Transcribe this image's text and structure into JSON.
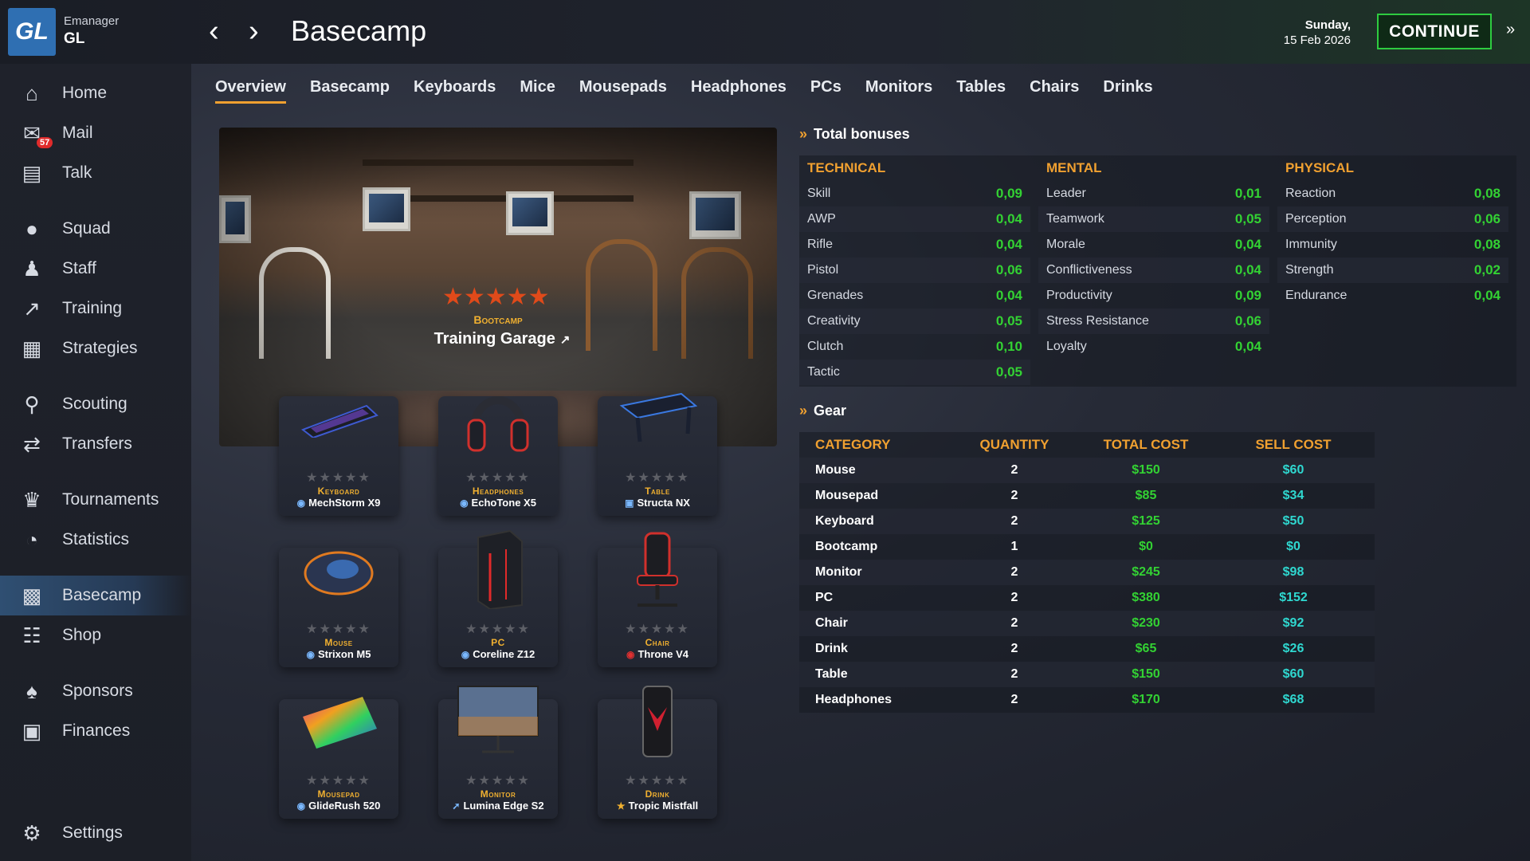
{
  "header": {
    "manager": "Emanager",
    "team": "GL",
    "logo": "GL",
    "title": "Basecamp",
    "day": "Sunday,",
    "date": "15 Feb 2026",
    "continue": "CONTINUE"
  },
  "sidebar": {
    "items": [
      {
        "label": "Home",
        "icon": "home-icon"
      },
      {
        "label": "Mail",
        "icon": "mail-icon",
        "badge": "57"
      },
      {
        "label": "Talk",
        "icon": "chat-icon"
      },
      {
        "label": "Squad",
        "icon": "squad-icon"
      },
      {
        "label": "Staff",
        "icon": "staff-icon"
      },
      {
        "label": "Training",
        "icon": "training-icon"
      },
      {
        "label": "Strategies",
        "icon": "strategies-icon"
      },
      {
        "label": "Scouting",
        "icon": "scouting-icon"
      },
      {
        "label": "Transfers",
        "icon": "transfers-icon"
      },
      {
        "label": "Tournaments",
        "icon": "trophy-icon"
      },
      {
        "label": "Statistics",
        "icon": "pie-chart-icon"
      },
      {
        "label": "Basecamp",
        "icon": "basecamp-icon"
      },
      {
        "label": "Shop",
        "icon": "cart-icon"
      },
      {
        "label": "Sponsors",
        "icon": "sponsor-icon"
      },
      {
        "label": "Finances",
        "icon": "briefcase-icon"
      },
      {
        "label": "Settings",
        "icon": "gear-icon"
      }
    ]
  },
  "tabs": [
    "Overview",
    "Basecamp",
    "Keyboards",
    "Mice",
    "Mousepads",
    "Headphones",
    "PCs",
    "Monitors",
    "Tables",
    "Chairs",
    "Drinks"
  ],
  "bootcamp": {
    "type": "Bootcamp",
    "name": "Training Garage",
    "stars": "★★★★★",
    "link_icon": "external-link-icon"
  },
  "gear_cards": [
    {
      "type": "Keyboard",
      "name": "MechStorm X9",
      "stars": "★★★★★"
    },
    {
      "type": "Headphones",
      "name": "EchoTone X5",
      "stars": "★★★★★"
    },
    {
      "type": "Table",
      "name": "Structa NX",
      "stars": "★★★★★"
    },
    {
      "type": "Mouse",
      "name": "Strixon M5",
      "stars": "★★★★★"
    },
    {
      "type": "PC",
      "name": "Coreline Z12",
      "stars": "★★★★★"
    },
    {
      "type": "Chair",
      "name": "Throne V4",
      "stars": "★★★★★"
    },
    {
      "type": "Mousepad",
      "name": "GlideRush 520",
      "stars": "★★★★★"
    },
    {
      "type": "Monitor",
      "name": "Lumina Edge S2",
      "stars": "★★★★★"
    },
    {
      "type": "Drink",
      "name": "Tropic Mistfall",
      "stars": "★★★★★"
    }
  ],
  "bonuses": {
    "title": "Total bonuses",
    "technical": {
      "label": "TECHNICAL",
      "rows": [
        [
          "Skill",
          "0,09"
        ],
        [
          "AWP",
          "0,04"
        ],
        [
          "Rifle",
          "0,04"
        ],
        [
          "Pistol",
          "0,06"
        ],
        [
          "Grenades",
          "0,04"
        ],
        [
          "Creativity",
          "0,05"
        ],
        [
          "Clutch",
          "0,10"
        ],
        [
          "Tactic",
          "0,05"
        ]
      ]
    },
    "mental": {
      "label": "MENTAL",
      "rows": [
        [
          "Leader",
          "0,01"
        ],
        [
          "Teamwork",
          "0,05"
        ],
        [
          "Morale",
          "0,04"
        ],
        [
          "Conflictiveness",
          "0,04"
        ],
        [
          "Productivity",
          "0,09"
        ],
        [
          "Stress Resistance",
          "0,06"
        ],
        [
          "Loyalty",
          "0,04"
        ]
      ]
    },
    "physical": {
      "label": "PHYSICAL",
      "rows": [
        [
          "Reaction",
          "0,08"
        ],
        [
          "Perception",
          "0,06"
        ],
        [
          "Immunity",
          "0,08"
        ],
        [
          "Strength",
          "0,02"
        ],
        [
          "Endurance",
          "0,04"
        ]
      ]
    }
  },
  "gear": {
    "title": "Gear",
    "headers": [
      "CATEGORY",
      "QUANTITY",
      "TOTAL COST",
      "SELL COST"
    ],
    "rows": [
      [
        "Mouse",
        "2",
        "$150",
        "$60"
      ],
      [
        "Mousepad",
        "2",
        "$85",
        "$34"
      ],
      [
        "Keyboard",
        "2",
        "$125",
        "$50"
      ],
      [
        "Bootcamp",
        "1",
        "$0",
        "$0"
      ],
      [
        "Monitor",
        "2",
        "$245",
        "$98"
      ],
      [
        "PC",
        "2",
        "$380",
        "$152"
      ],
      [
        "Chair",
        "2",
        "$230",
        "$92"
      ],
      [
        "Drink",
        "2",
        "$65",
        "$26"
      ],
      [
        "Table",
        "2",
        "$150",
        "$60"
      ],
      [
        "Headphones",
        "2",
        "$170",
        "$68"
      ]
    ]
  }
}
